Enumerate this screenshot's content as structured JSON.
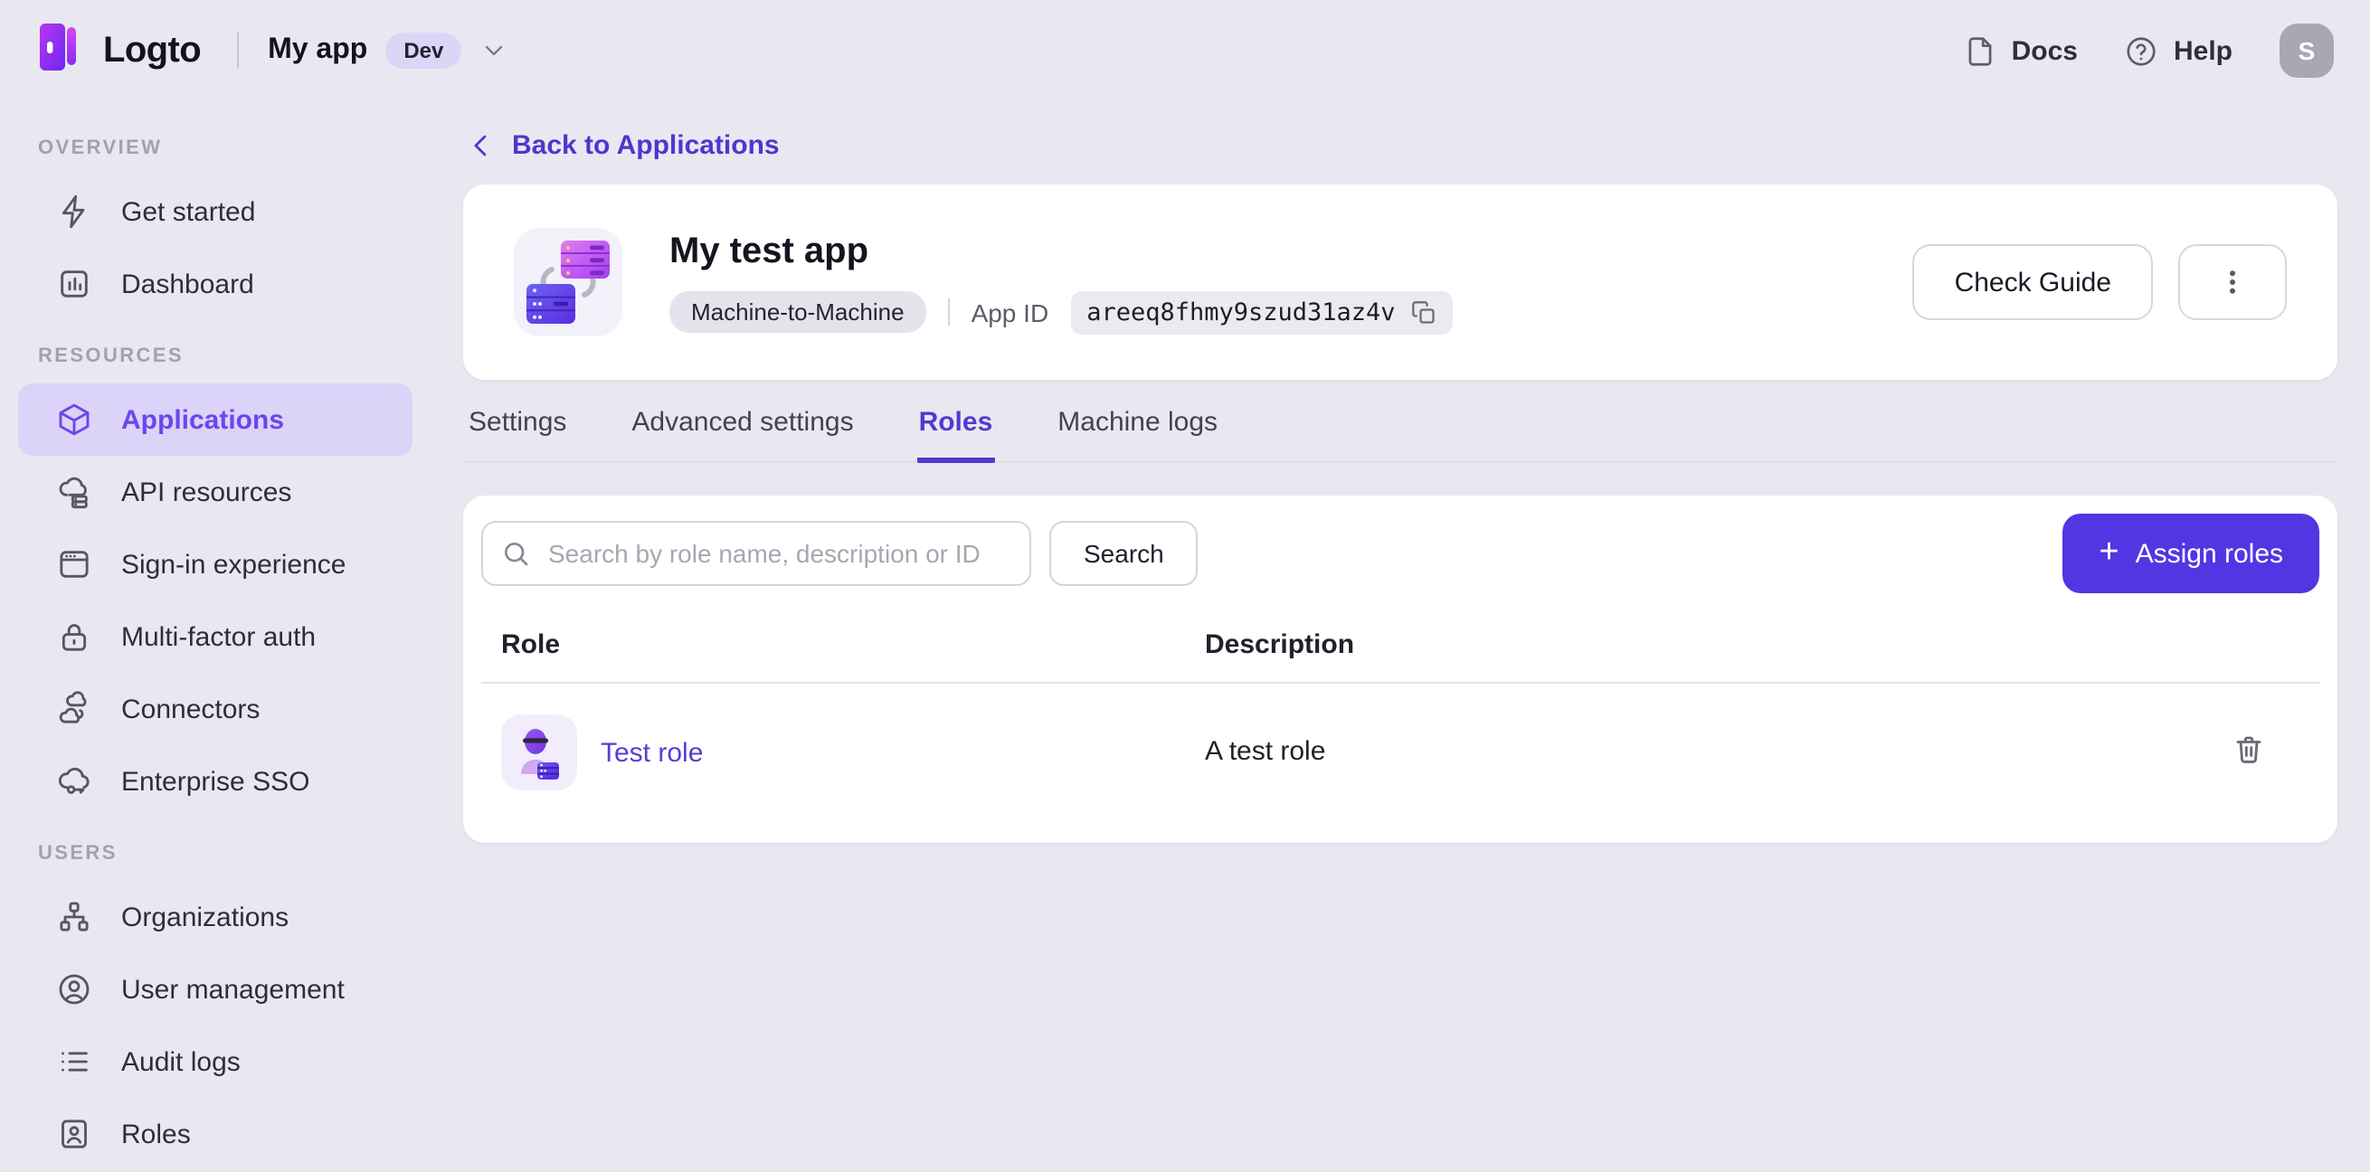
{
  "topbar": {
    "brand": "Logto",
    "tenant_name": "My app",
    "env_badge": "Dev",
    "docs_label": "Docs",
    "help_label": "Help",
    "avatar_initial": "S"
  },
  "sidebar": {
    "sections": [
      {
        "label": "OVERVIEW",
        "items": [
          {
            "label": "Get started"
          },
          {
            "label": "Dashboard"
          }
        ]
      },
      {
        "label": "RESOURCES",
        "items": [
          {
            "label": "Applications",
            "active": true
          },
          {
            "label": "API resources"
          },
          {
            "label": "Sign-in experience"
          },
          {
            "label": "Multi-factor auth"
          },
          {
            "label": "Connectors"
          },
          {
            "label": "Enterprise SSO"
          }
        ]
      },
      {
        "label": "USERS",
        "items": [
          {
            "label": "Organizations"
          },
          {
            "label": "User management"
          },
          {
            "label": "Audit logs"
          },
          {
            "label": "Roles"
          }
        ]
      }
    ]
  },
  "page": {
    "back_link": "Back to Applications"
  },
  "app_card": {
    "title": "My test app",
    "type_badge": "Machine-to-Machine",
    "app_id_label": "App ID",
    "app_id_value": "areeq8fhmy9szud31az4v",
    "check_guide_label": "Check Guide"
  },
  "tabs": [
    {
      "label": "Settings"
    },
    {
      "label": "Advanced settings"
    },
    {
      "label": "Roles",
      "active": true
    },
    {
      "label": "Machine logs"
    }
  ],
  "roles_panel": {
    "search_placeholder": "Search by role name, description or ID",
    "search_button": "Search",
    "assign_button": "Assign roles",
    "table": {
      "headers": [
        "Role",
        "Description"
      ],
      "rows": [
        {
          "role": "Test role",
          "description": "A test role"
        }
      ]
    }
  },
  "colors": {
    "primary_button": "#5335e4",
    "link": "#5438d2",
    "sidebar_active": "#6d45ee",
    "page_background": "#e9e8f1",
    "selected_pill": "#dbd3f8"
  }
}
